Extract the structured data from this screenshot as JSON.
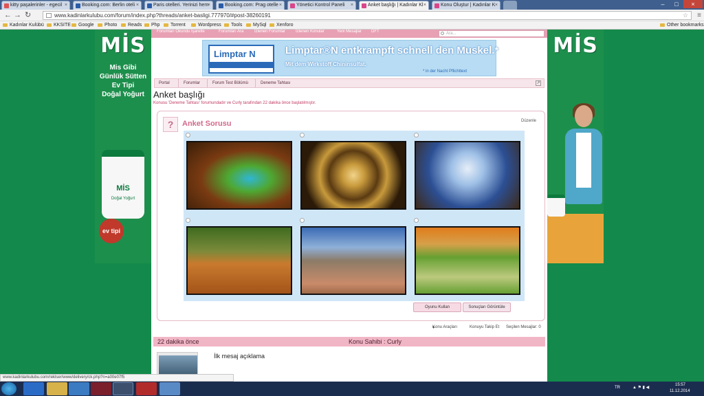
{
  "browser": {
    "tabs": [
      {
        "label": "kitty paşalerinler - egecil",
        "color": "#e05454"
      },
      {
        "label": "Booking.com: Berlin oteli",
        "color": "#2a5ca8"
      },
      {
        "label": "Paris otelleri. Yerinizi hem",
        "color": "#2a5ca8"
      },
      {
        "label": "Booking.com: Prag otelle",
        "color": "#2a5ca8"
      },
      {
        "label": "Yönetici Kontrol Paneli",
        "color": "#d9468a"
      },
      {
        "label": "Anket başlığı | Kadınlar Kl",
        "color": "#d9468a"
      },
      {
        "label": "Konu Oluştur | Kadınlar K",
        "color": "#d9468a"
      }
    ],
    "url": "www.kadinlarkulubu.com/forum/index.php?threads/anket-basligi.777970/#post-38260191",
    "bookmarks": [
      "Kadınlar Kulübü",
      "KKSITE",
      "Google",
      "Photo",
      "Reads",
      "Php",
      "Torrent",
      "Wordpress",
      "Tools",
      "MySql",
      "Xenforo"
    ],
    "other_bookmarks": "Other bookmarks"
  },
  "side_ad": {
    "logo": "MİS",
    "slogan": [
      "Mis Gibi",
      "Günlük Sütten",
      "Ev Tipi",
      "Doğal Yoğurt"
    ],
    "jar_brand": "MİS",
    "jar_label": "Doğal Yoğurt",
    "badge": "ev tipi"
  },
  "forum": {
    "nav": [
      "Forumları Okundu İşaretle",
      "Forumları Ara",
      "İzlenen Forumlar",
      "İzlenen Konular",
      "Yeni Mesajlar",
      "DFT"
    ],
    "search_placeholder": "Ara...",
    "banner": {
      "box_text": "Limptar N",
      "headline": "Limptar®N entkrampft schnell den Muskel.*",
      "sub": "Mit dem Wirkstoff Chininsulfat.",
      "note": "* in der Nacht   Pflichttext"
    },
    "breadcrumb": [
      "Portal",
      "Forumlar",
      "Forum Test Bölümü",
      "Deneme Tahtası"
    ],
    "title": "Anket başlığı",
    "description": "Konusu 'Deneme Tahtası' forumundadır ve Curly tarafından 22 dakika önce başlatılmıştır.",
    "poll": {
      "icon": "?",
      "title": "Anket Sorusu",
      "edit": "Düzenle",
      "options": [
        {
          "name": "lizard-photo",
          "colors": [
            "#7a3b12",
            "#4ea832",
            "#2fb6d4"
          ]
        },
        {
          "name": "dome-photo",
          "colors": [
            "#5a3a12",
            "#c89a3c",
            "#2b1a08"
          ]
        },
        {
          "name": "trees-sky-photo",
          "colors": [
            "#2c4f94",
            "#9fc0e6",
            "#3c2a1a"
          ]
        },
        {
          "name": "autumn-forest-photo",
          "colors": [
            "#3f6b1f",
            "#a35419",
            "#c97a2e"
          ]
        },
        {
          "name": "stone-tower-photo",
          "colors": [
            "#3b6bb5",
            "#8c7b68",
            "#c98b6a"
          ]
        },
        {
          "name": "couple-field-photo",
          "colors": [
            "#e07c1c",
            "#66a032",
            "#bcc97e"
          ]
        }
      ],
      "vote_button": "Oyunu Kullan",
      "results_button": "Sonuçları Görüntüle"
    },
    "thread_tools": "Konu Araçları",
    "follow": "Konuyu Takip Et",
    "selected": "Seçilen Mesajlar: 0",
    "post_time": "22 dakika önce",
    "post_owner": "Konu Sahibi : Curly",
    "post_text": "İlk mesaj açıklama"
  },
  "status_url": "www.kadinlarkulubu.com/reklser/www/delivery/ck.php?n=a00e07f5",
  "taskbar": {
    "lang": "TR",
    "time": "15:57",
    "date": "11.12.2014"
  }
}
